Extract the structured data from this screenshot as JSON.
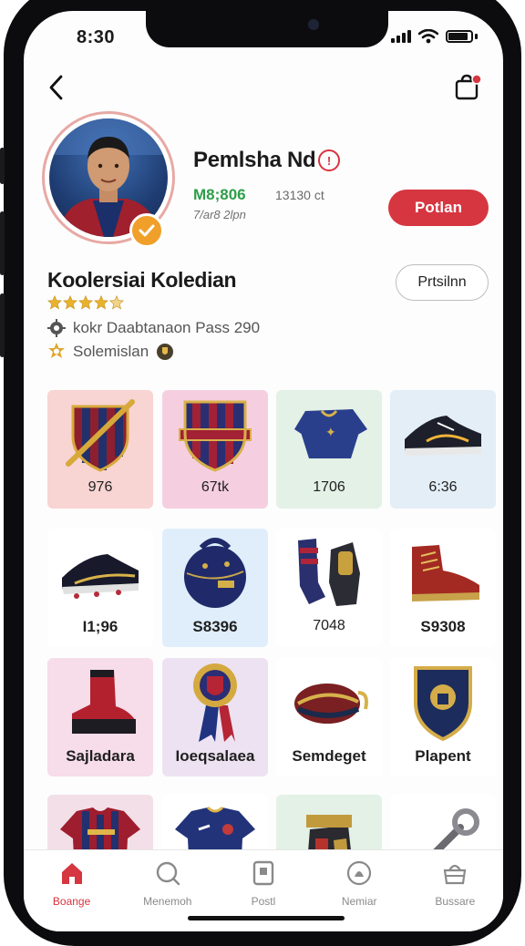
{
  "status_bar": {
    "time": "8:30"
  },
  "profile": {
    "name": "Pemlsha Nd",
    "name_badge": "!",
    "stat_primary": "M8;806",
    "stat_secondary": "13130 ct",
    "subtitle": "7/ar8 2lpn",
    "follow_label": "Potlan"
  },
  "collection": {
    "title": "Koolersiai Koledian",
    "button_label": "Prtsilnn",
    "rating": 4,
    "pass_text": "kokr Daabtanaon Pass 290",
    "solemn_text": "Solemislan"
  },
  "items": [
    {
      "label": "976",
      "icon": "shield-pen",
      "bg": "#f8d4d2"
    },
    {
      "label": "67tk",
      "icon": "club-crest",
      "bg": "#f5cfe0"
    },
    {
      "label": "1706",
      "icon": "blue-cap",
      "bg": "#e3f1e6"
    },
    {
      "label": "6:36",
      "icon": "black-sneaker",
      "bg": "#e4eef7"
    },
    {
      "label": "I1;96",
      "icon": "black-boot",
      "bg": "#ffffff"
    },
    {
      "label": "S8396",
      "icon": "navy-ball",
      "bg": "#dfeefa"
    },
    {
      "label": "7048",
      "icon": "socks-gloves",
      "bg": "#ffffff"
    },
    {
      "label": "S9308",
      "icon": "red-boot",
      "bg": "#ffffff"
    },
    {
      "label": "Sajladara",
      "icon": "red-black-boot",
      "bg": "#f7dce9"
    },
    {
      "label": "Ioeqsalaea",
      "icon": "medal-ribbon",
      "bg": "#ede2f2"
    },
    {
      "label": "Semdeget",
      "icon": "red-glasses",
      "bg": "#ffffff"
    },
    {
      "label": "Plapent",
      "icon": "badge-plaque",
      "bg": "#ffffff"
    },
    {
      "label": "",
      "icon": "striped-jersey",
      "bg": "#f3dfe8"
    },
    {
      "label": "",
      "icon": "navy-jersey",
      "bg": "#ffffff"
    },
    {
      "label": "",
      "icon": "bag-item",
      "bg": "#e3f1e6"
    },
    {
      "label": "",
      "icon": "wrench-item",
      "bg": "#ffffff"
    }
  ],
  "nav": [
    {
      "label": "Boange",
      "icon": "home-icon",
      "active": true
    },
    {
      "label": "Menemoh",
      "icon": "search-icon",
      "active": false
    },
    {
      "label": "Postl",
      "icon": "doc-icon",
      "active": false
    },
    {
      "label": "Nemiar",
      "icon": "bell-icon",
      "active": false
    },
    {
      "label": "Bussare",
      "icon": "bag-icon",
      "active": false
    }
  ],
  "colors": {
    "accent": "#d63640",
    "green": "#2e9e48",
    "gold": "#f0a02a"
  }
}
